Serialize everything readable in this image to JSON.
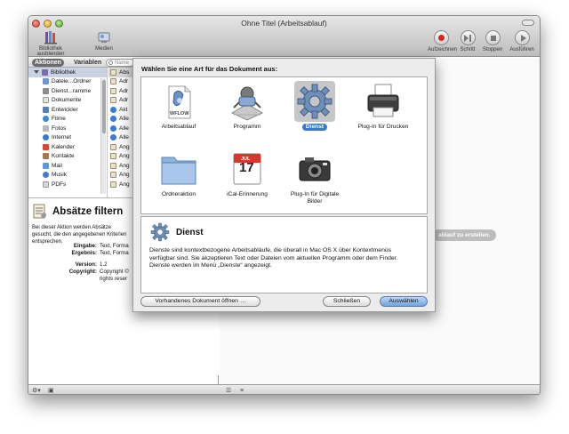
{
  "window": {
    "title": "Ohne Titel (Arbeitsablauf)"
  },
  "toolbar": {
    "hide_library_label": "Bibliothek ausblenden",
    "media_label": "Medien",
    "record_label": "Aufzeichnen",
    "step_label": "Schritt",
    "stop_label": "Stoppen",
    "run_label": "Ausführen"
  },
  "library": {
    "tab_actions": "Aktionen",
    "tab_variables": "Variablen",
    "search_placeholder": "Name",
    "items": [
      {
        "label": "Bibliothek",
        "icon": "library-icon"
      },
      {
        "label": "Dateie...Ordner",
        "icon": "finder-icon"
      },
      {
        "label": "Dienst...ramme",
        "icon": "utilities-icon"
      },
      {
        "label": "Dokumente",
        "icon": "documents-icon"
      },
      {
        "label": "Entwickler",
        "icon": "developer-icon"
      },
      {
        "label": "Filme",
        "icon": "movies-icon"
      },
      {
        "label": "Fotos",
        "icon": "photos-icon"
      },
      {
        "label": "Internet",
        "icon": "internet-icon"
      },
      {
        "label": "Kalender",
        "icon": "calendar-icon"
      },
      {
        "label": "Kontakte",
        "icon": "contacts-icon"
      },
      {
        "label": "Mail",
        "icon": "mail-icon"
      },
      {
        "label": "Musik",
        "icon": "music-icon"
      },
      {
        "label": "PDFs",
        "icon": "pdf-icon"
      }
    ],
    "actions": [
      {
        "label": "Abs"
      },
      {
        "label": "Adr"
      },
      {
        "label": "Adr"
      },
      {
        "label": "Adr"
      },
      {
        "label": "Akt"
      },
      {
        "label": "Alle"
      },
      {
        "label": "Alle"
      },
      {
        "label": "Alle"
      },
      {
        "label": "Ang"
      },
      {
        "label": "Ang"
      },
      {
        "label": "Ang"
      },
      {
        "label": "Ang"
      },
      {
        "label": "Ang"
      }
    ]
  },
  "description": {
    "title": "Absätze filtern",
    "text": "Bei dieser Aktion werden Absätze gesucht, die den angegebenen Kriterien entsprechen.",
    "input_label": "Eingabe:",
    "input_value": "Text, Forma",
    "result_label": "Ergebnis:",
    "result_value": "Text, Forma",
    "version_label": "Version:",
    "version_value": "1.2",
    "copyright_label": "Copyright:",
    "copyright_value_1": "Copyright ©",
    "copyright_value_2": "rights reser"
  },
  "workflow": {
    "hint": "ablauf zu erstellen."
  },
  "sheet": {
    "prompt": "Wählen Sie eine Art für das Dokument aus:",
    "types": [
      {
        "label": "Arbeitsablauf",
        "icon": "workflow-icon",
        "badge": "WFLOW"
      },
      {
        "label": "Programm",
        "icon": "application-icon"
      },
      {
        "label": "Dienst",
        "icon": "service-gear-icon",
        "selected": true
      },
      {
        "label": "Plug-In für Drucken",
        "icon": "printer-icon"
      },
      {
        "label": "Ordneraktion",
        "icon": "folder-icon"
      },
      {
        "label": "iCal-Erinnerung",
        "icon": "ical-icon",
        "cal_month": "JUL",
        "cal_day": "17"
      },
      {
        "label": "Plug-In für Digitale Bilder",
        "icon": "camera-icon"
      }
    ],
    "detail_title": "Dienst",
    "detail_text": "Dienste sind kontextbezogene Arbeitsabläufe, die überall in Mac OS X über Kontextmenüs verfügbar sind. Sie akzeptieren Text oder Dateien vom aktuellen Programm oder dem Finder. Dienste werden im Menü „Dienste“ angezeigt.",
    "open_existing": "Vorhandenes Dokument öffnen …",
    "close": "Schließen",
    "choose": "Auswählen"
  },
  "colors": {
    "accent": "#3a79d3",
    "record": "#d8241c"
  }
}
